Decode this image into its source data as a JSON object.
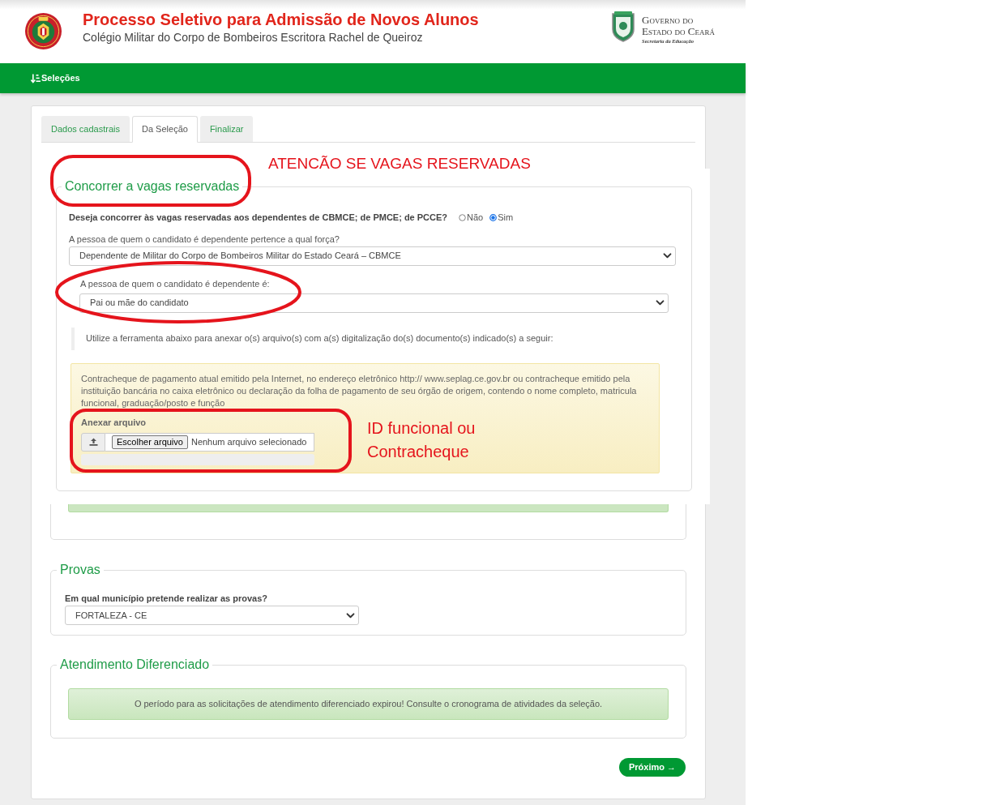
{
  "header": {
    "title": "Processo Seletivo para Admissão de Novos Alunos",
    "subtitle": "Colégio Militar do Corpo de Bombeiros Escritora Rachel de Queiroz",
    "state_logo": {
      "lines": [
        "Governo do",
        "Estado do Ceará"
      ],
      "tagline": "Secretaria da Educação"
    }
  },
  "nav": {
    "items": [
      {
        "label": "Seleções"
      }
    ]
  },
  "tabs": [
    {
      "label": "Dados cadastrais",
      "selected": false
    },
    {
      "label": "Da Seleção",
      "selected": true
    },
    {
      "label": "Finalizar",
      "selected": false
    }
  ],
  "reserved_places": {
    "legend": "Concorrer a vagas reservadas",
    "question": "Deseja concorrer às vagas reservadas aos dependentes de CBMCE; de PMCE; de PCCE?",
    "options": [
      {
        "label": "Não",
        "selected": false
      },
      {
        "label": "Sim",
        "selected": true
      }
    ],
    "force": {
      "label": "A pessoa de quem o candidato é dependente pertence a qual força?",
      "value": "Dependente de Militar do Corpo de Bombeiros Militar do Estado Ceará – CBMCE"
    },
    "relation": {
      "label": "A pessoa de quem o candidato é dependente é:",
      "value": "Pai ou mãe do candidato"
    },
    "instruction": "Utilize a ferramenta abaixo para anexar o(s) arquivo(s) com a(s) digitalização do(s) documento(s) indicado(s) a seguir:",
    "document": {
      "description": "Contracheque de pagamento atual emitido pela Internet, no endereço eletrônico http:// www.seplag.ce.gov.br ou contracheque emitido pela instituição bancária no caixa eletrônico ou declaração da folha de pagamento de seu órgão de origem, contendo o nome completo, matricula funcional, graduação/posto e função",
      "attach_label": "Anexar arquivo",
      "file_button": "Escolher arquivo",
      "file_status": "Nenhum arquivo selecionado"
    }
  },
  "exams": {
    "legend": "Provas",
    "label": "Em qual município pretende realizar as provas?",
    "value": "FORTALEZA - CE"
  },
  "special_care": {
    "legend": "Atendimento Diferenciado",
    "message": "O período para as solicitações de atendimento diferenciado expirou! Consulte o cronograma de atividades da seleção."
  },
  "next_button": {
    "label": "Próximo →"
  },
  "annotations": [
    {
      "kind": "outline"
    },
    {
      "kind": "note",
      "text": "ATENCÃO SE VAGAS RESERVADAS"
    },
    {
      "kind": "ellipse"
    },
    {
      "kind": "outline"
    },
    {
      "kind": "note",
      "text": "ID funcional ou Contracheque"
    }
  ]
}
